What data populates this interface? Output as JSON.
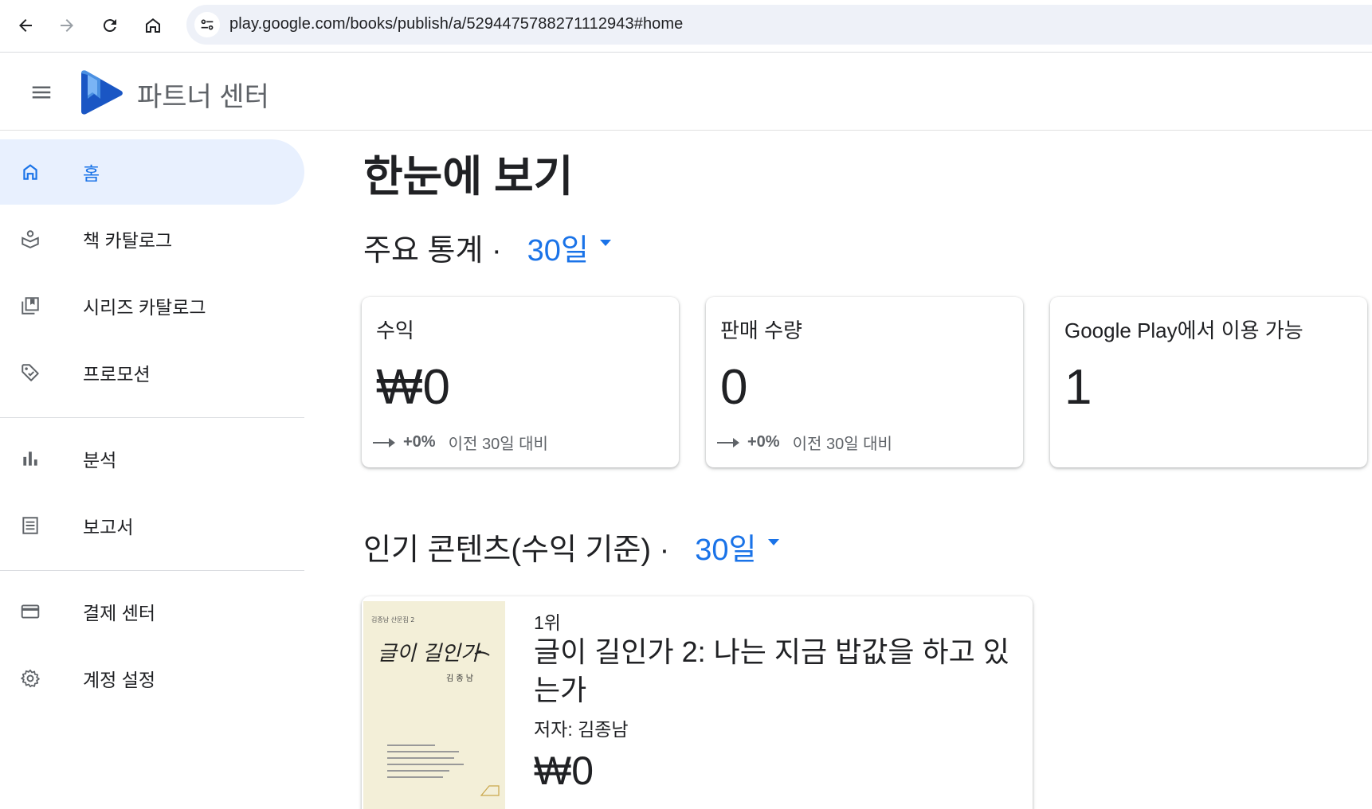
{
  "browser": {
    "url": "play.google.com/books/publish/a/5294475788271112943#home"
  },
  "header": {
    "app_title": "파트너 센터"
  },
  "sidebar": {
    "items": [
      {
        "label": "홈",
        "icon": "home-icon",
        "active": true
      },
      {
        "label": "책 카탈로그",
        "icon": "book-catalog-icon"
      },
      {
        "label": "시리즈 카탈로그",
        "icon": "series-catalog-icon"
      },
      {
        "label": "프로모션",
        "icon": "tag-icon"
      },
      {
        "label": "분석",
        "icon": "bar-chart-icon"
      },
      {
        "label": "보고서",
        "icon": "report-icon"
      },
      {
        "label": "결제 센터",
        "icon": "credit-card-icon"
      },
      {
        "label": "계정 설정",
        "icon": "gear-icon"
      }
    ]
  },
  "main": {
    "page_title": "한눈에 보기",
    "stats_section": {
      "title": "주요 통계 ·",
      "period": "30일"
    },
    "cards": [
      {
        "title": "수익",
        "value": "₩0",
        "delta_pct": "+0%",
        "delta_label": "이전 30일 대비"
      },
      {
        "title": "판매 수량",
        "value": "0",
        "delta_pct": "+0%",
        "delta_label": "이전 30일 대비"
      },
      {
        "title": "Google Play에서 이용 가능",
        "value": "1"
      }
    ],
    "popular_section": {
      "title": "인기 콘텐츠(수익 기준) ·",
      "period": "30일"
    },
    "top_book": {
      "rank": "1위",
      "title": "글이 길인가 2: 나는 지금 밥값을 하고 있는가",
      "author": "저자: 김종남",
      "revenue": "₩0",
      "cover_title": "글이 길인가"
    }
  },
  "colors": {
    "accent": "#1a73e8",
    "active_bg": "#e8f0fe",
    "text": "#202124",
    "muted": "#5f6368"
  }
}
